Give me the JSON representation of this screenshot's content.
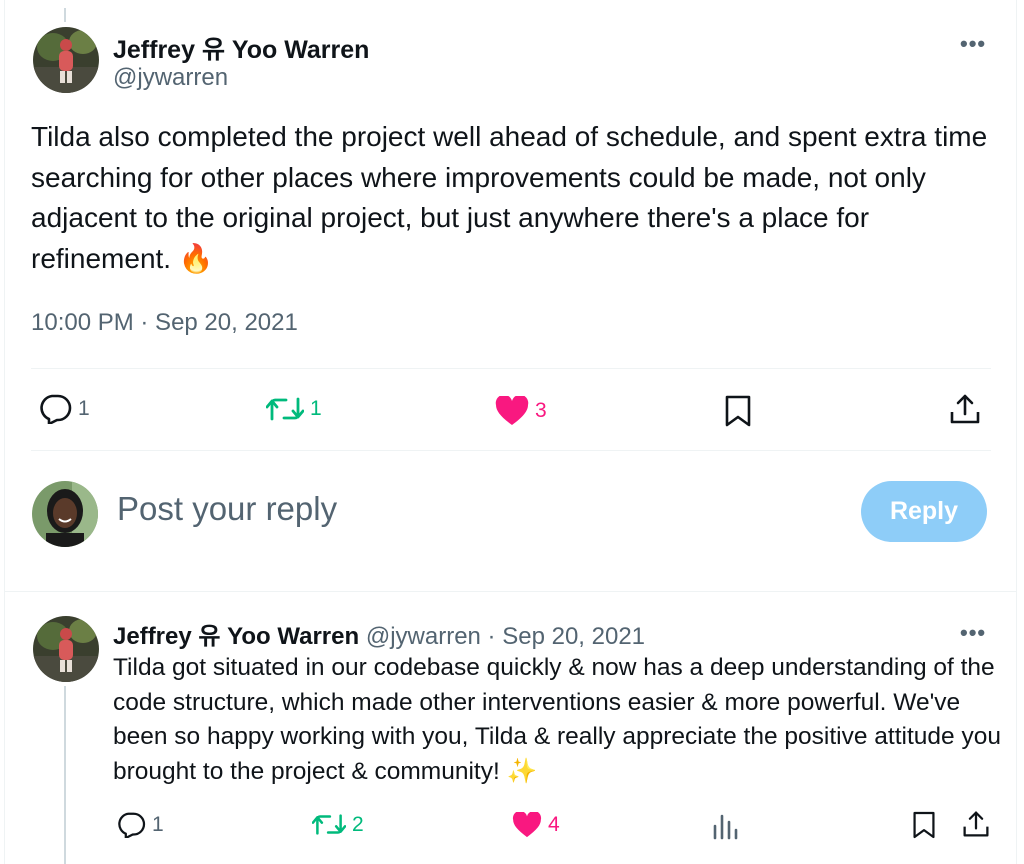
{
  "main_tweet": {
    "author_name": "Jeffrey 유 Yoo Warren",
    "author_handle": "@jywarren",
    "more_label": "•••",
    "text": "Tilda also completed the project well ahead of schedule, and spent extra time searching for other places where improvements could be made, not only adjacent to the original project, but just anywhere there's a place for refinement. 🔥",
    "timestamp": "10:00 PM · Sep 20, 2021",
    "actions": {
      "replies": "1",
      "retweets": "1",
      "likes": "3"
    }
  },
  "reply_box": {
    "placeholder": "Post your reply",
    "button_label": "Reply"
  },
  "reply_tweet": {
    "author_name": "Jeffrey 유 Yoo Warren",
    "author_handle": "@jywarren",
    "separator": " · ",
    "date": "Sep 20, 2021",
    "more_label": "•••",
    "text": "Tilda got situated in our codebase quickly & now has a deep understanding of the code structure, which made other interventions easier & more powerful. We've been so happy working with you, Tilda & really appreciate the positive attitude you brought to the project & community! ✨",
    "actions": {
      "replies": "1",
      "retweets": "2",
      "likes": "4"
    }
  },
  "colors": {
    "text_primary": "#0f1419",
    "text_secondary": "#536471",
    "retweet_green": "#00ba7c",
    "like_pink": "#f91880",
    "reply_button_disabled": "#8ecdf8",
    "divider": "#eff3f4"
  },
  "icons": {
    "reply": "speech-bubble-icon",
    "retweet": "retweet-arrows-icon",
    "like": "heart-filled-icon",
    "bookmark": "bookmark-icon",
    "share": "share-upload-icon",
    "views": "bar-chart-icon",
    "more": "ellipsis-icon"
  }
}
